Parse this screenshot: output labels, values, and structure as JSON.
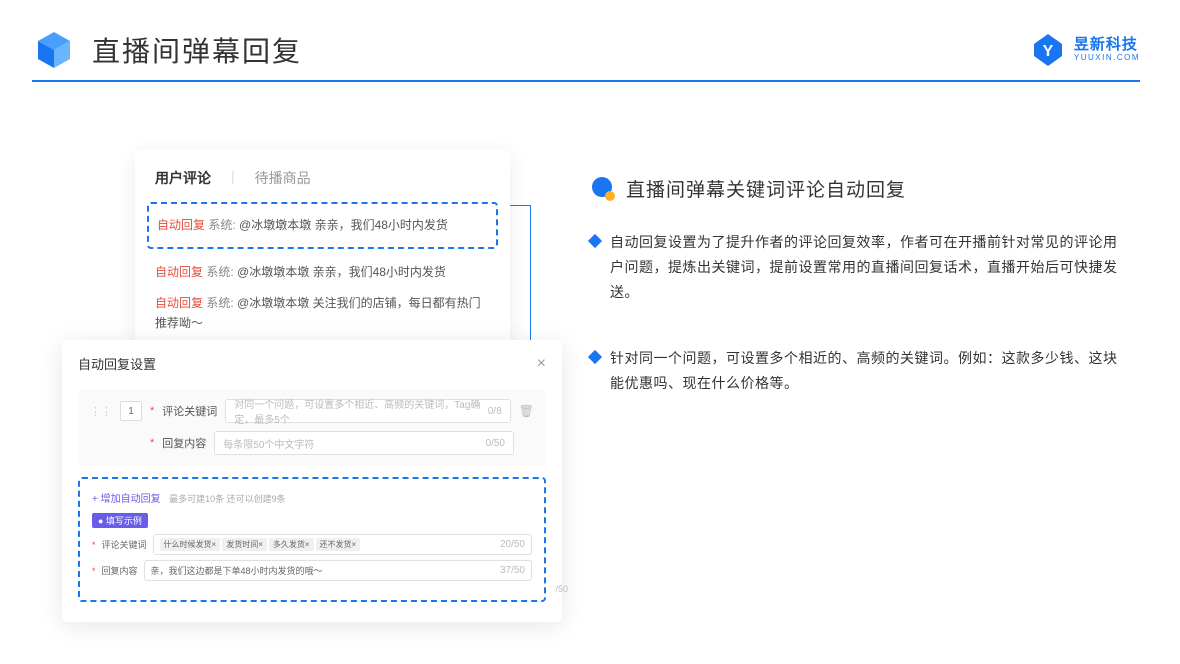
{
  "header": {
    "title": "直播间弹幕回复",
    "brand_cn": "昱新科技",
    "brand_en": "YUUXIN.COM"
  },
  "comments": {
    "tab1": "用户评论",
    "tab2": "待播商品",
    "auto_tag": "自动回复",
    "sys_tag": "系统:",
    "c1": "@冰墩墩本墩 亲亲，我们48小时内发货",
    "c2": "@冰墩墩本墩 亲亲，我们48小时内发货",
    "c3": "@冰墩墩本墩 关注我们的店铺，每日都有热门推荐呦～"
  },
  "settings": {
    "title": "自动回复设置",
    "row_num": "1",
    "label_keyword": "评论关键词",
    "ph_keyword": "对同一个问题，可设置多个相近、高频的关键词，Tag确定，最多5个",
    "count_kw": "0/8",
    "label_content": "回复内容",
    "ph_content": "每条限50个中文字符",
    "count_ct": "0/50",
    "add_link": "+ 增加自动回复",
    "add_note": "最多可建10条 还可以创建9条",
    "badge": "● 填写示例",
    "ex_label_kw": "评论关键词",
    "tags": [
      "什么时候发货×",
      "发货时间×",
      "多久发货×",
      "还不发货×"
    ],
    "ex_kw_count": "20/50",
    "ex_label_ct": "回复内容",
    "ex_content": "亲，我们这边都是下单48小时内发货的哦～",
    "ex_ct_count": "37/50",
    "outer_count": "/50"
  },
  "right": {
    "section_title": "直播间弹幕关键词评论自动回复",
    "b1": "自动回复设置为了提升作者的评论回复效率，作者可在开播前针对常见的评论用户问题，提炼出关键词，提前设置常用的直播间回复话术，直播开始后可快捷发送。",
    "b2": "针对同一个问题，可设置多个相近的、高频的关键词。例如：这款多少钱、这块能优惠吗、现在什么价格等。"
  }
}
